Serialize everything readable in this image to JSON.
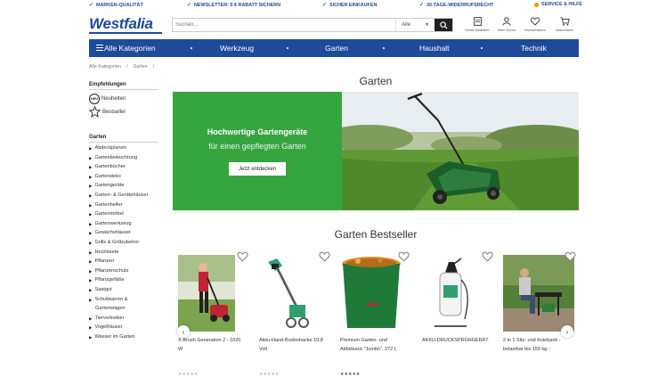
{
  "topbar": {
    "usps": [
      "MARKEN-QUALITÄT",
      "NEWSLETTER: 5 € RABATT SICHERN",
      "SICHER EINKAUFEN",
      "30-TAGE-WIDERRUFSRECHT"
    ],
    "service": "SERVICE & HILFE"
  },
  "header": {
    "logo": "Westfalia",
    "search_placeholder": "Suchen...",
    "search_scope": "Alle",
    "icons": [
      {
        "label": "Direkt bestellen",
        "icon": "document-icon"
      },
      {
        "label": "Mein Konto",
        "icon": "user-icon"
      },
      {
        "label": "Wunschlisten",
        "icon": "heart-icon"
      },
      {
        "label": "Warenkorb",
        "icon": "cart-icon"
      }
    ]
  },
  "nav": {
    "all": "Alle Kategorien",
    "items": [
      "Werkzeug",
      "Garten",
      "Haushalt",
      "Technik"
    ]
  },
  "breadcrumb": [
    "Alle Kategorien",
    "/",
    "Garten",
    "/"
  ],
  "sidebar": {
    "empf_title": "Empfehlungen",
    "neu_badge": "NEU",
    "neuheiten": "Neuheiten",
    "bestseller": "Bestseller",
    "cat_title": "Garten",
    "categories": [
      "Abdeckplanen",
      "Gartenbeleuchtung",
      "Gartenbücher",
      "Gartendeko",
      "Gartengeräte",
      "Garten- & Gerätehäuser",
      "Gartenhelfer",
      "Gartenmöbel",
      "Gartenwerkzeug",
      "Gewächshäuser",
      "Grills & Grillzubehör",
      "Hochbeete",
      "Pflanzen",
      "Pflanzenschutz",
      "Pflanzgefäße",
      "Saatgut",
      "Schubkarren &",
      "Tiervertreiber",
      "Vogelhäuser",
      "Wasser im Garten"
    ],
    "cat_extra": "Gartenwägen"
  },
  "main": {
    "title": "Garten",
    "hero_headline": "Hochwertige Gartengeräte",
    "hero_sub": "für einen gepflegten Garten",
    "hero_cta": "Jetzt entdecken",
    "bestseller_title": "Garten Bestseller",
    "products": [
      {
        "line1": "X-Brush Generation 2 - 1020",
        "line2": "W"
      },
      {
        "line1": "Akku-Hand-Bodenhacke 10,8",
        "line2": "Volt"
      },
      {
        "line1": "Premium Garten- und",
        "line2": "Abfallsack \"Jumbo\", 272 l,"
      },
      {
        "line1": "AKKU-DRUCKSPRÜHGERÄT",
        "line2": ""
      },
      {
        "line1": "2 in 1 Sitz- und Kniebank -",
        "line2": "belastbar bis 150 kg -"
      }
    ],
    "stars": "★★★★★"
  },
  "colors": {
    "brand": "#1e4a9a",
    "hero_green": "#36a540",
    "service": "#f39200"
  }
}
